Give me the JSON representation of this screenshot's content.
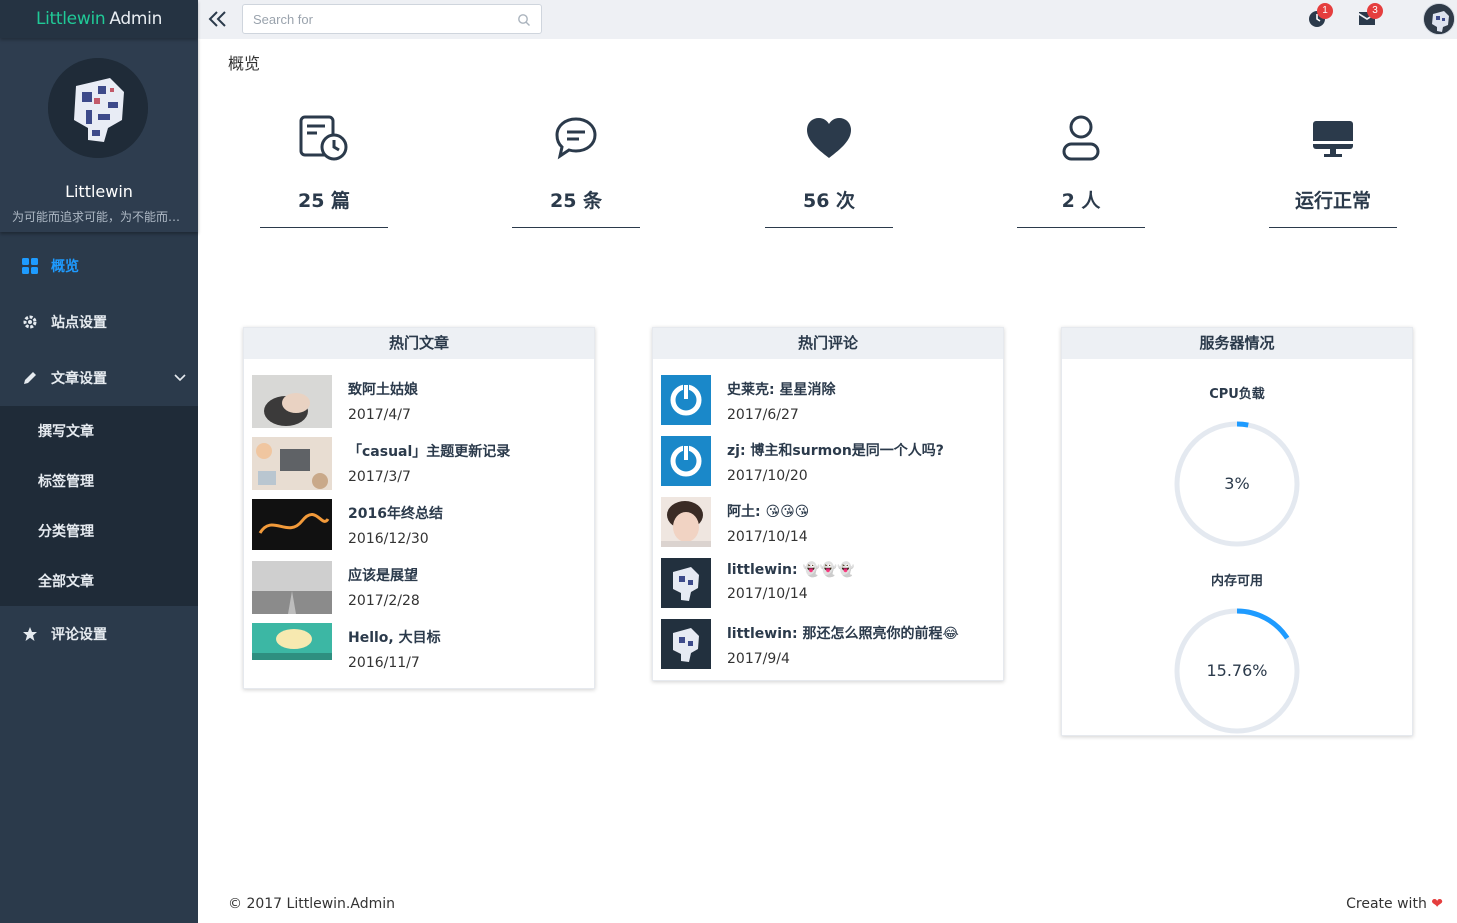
{
  "brand": {
    "name": "Littlewin",
    "suffix": "Admin",
    "accent": "#20c997"
  },
  "profile": {
    "name": "Littlewin",
    "motto": "为可能而追求可能，为不能而追求不能"
  },
  "menu": {
    "items": [
      {
        "label": "概览",
        "icon": "dashboard-icon",
        "active": true
      },
      {
        "label": "站点设置",
        "icon": "gear-icon"
      },
      {
        "label": "文章设置",
        "icon": "pencil-icon",
        "expanded": true,
        "children": [
          "撰写文章",
          "标签管理",
          "分类管理",
          "全部文章"
        ]
      },
      {
        "label": "评论设置",
        "icon": "star-icon"
      }
    ]
  },
  "topbar": {
    "search_placeholder": "Search for",
    "notifications_count": "1",
    "messages_count": "3"
  },
  "page": {
    "title": "概览"
  },
  "stats": [
    {
      "icon": "article-clock-icon",
      "value": "25 篇"
    },
    {
      "icon": "chat-bubble-icon",
      "value": "25 条"
    },
    {
      "icon": "heart-icon",
      "value": "56 次"
    },
    {
      "icon": "user-icon",
      "value": "2 人"
    },
    {
      "icon": "monitor-icon",
      "value": "运行正常"
    }
  ],
  "hot_articles": {
    "title": "热门文章",
    "items": [
      {
        "title": "致阿土姑娘",
        "date": "2017/4/7"
      },
      {
        "title": "「casual」主题更新记录",
        "date": "2017/3/7"
      },
      {
        "title": "2016年终总结",
        "date": "2016/12/30"
      },
      {
        "title": "应该是展望",
        "date": "2017/2/28"
      },
      {
        "title": "Hello, 大目标",
        "date": "2016/11/7"
      }
    ]
  },
  "hot_comments": {
    "title": "热门评论",
    "items": [
      {
        "text": "史莱克: 星星消除",
        "date": "2017/6/27"
      },
      {
        "text": "zj: 博主和surmon是同一个人吗?",
        "date": "2017/10/20"
      },
      {
        "text": "阿土: 😘😘😘",
        "date": "2017/10/14"
      },
      {
        "text": "littlewin: 👻👻👻",
        "date": "2017/10/14"
      },
      {
        "text": "littlewin: 那还怎么照亮你的前程😂",
        "date": "2017/9/4"
      }
    ]
  },
  "server": {
    "title": "服务器情况",
    "cpu_label": "CPU负载",
    "cpu_value": "3%",
    "cpu_fraction": 0.03,
    "mem_label": "内存可用",
    "mem_value": "15.76%",
    "mem_fraction": 0.1576,
    "gauge_color": "#1e9bff",
    "track_color": "#e4e9f0"
  },
  "footer": {
    "copyright": "© 2017 Littlewin.Admin",
    "create": "Create with",
    "heart": "❤"
  }
}
